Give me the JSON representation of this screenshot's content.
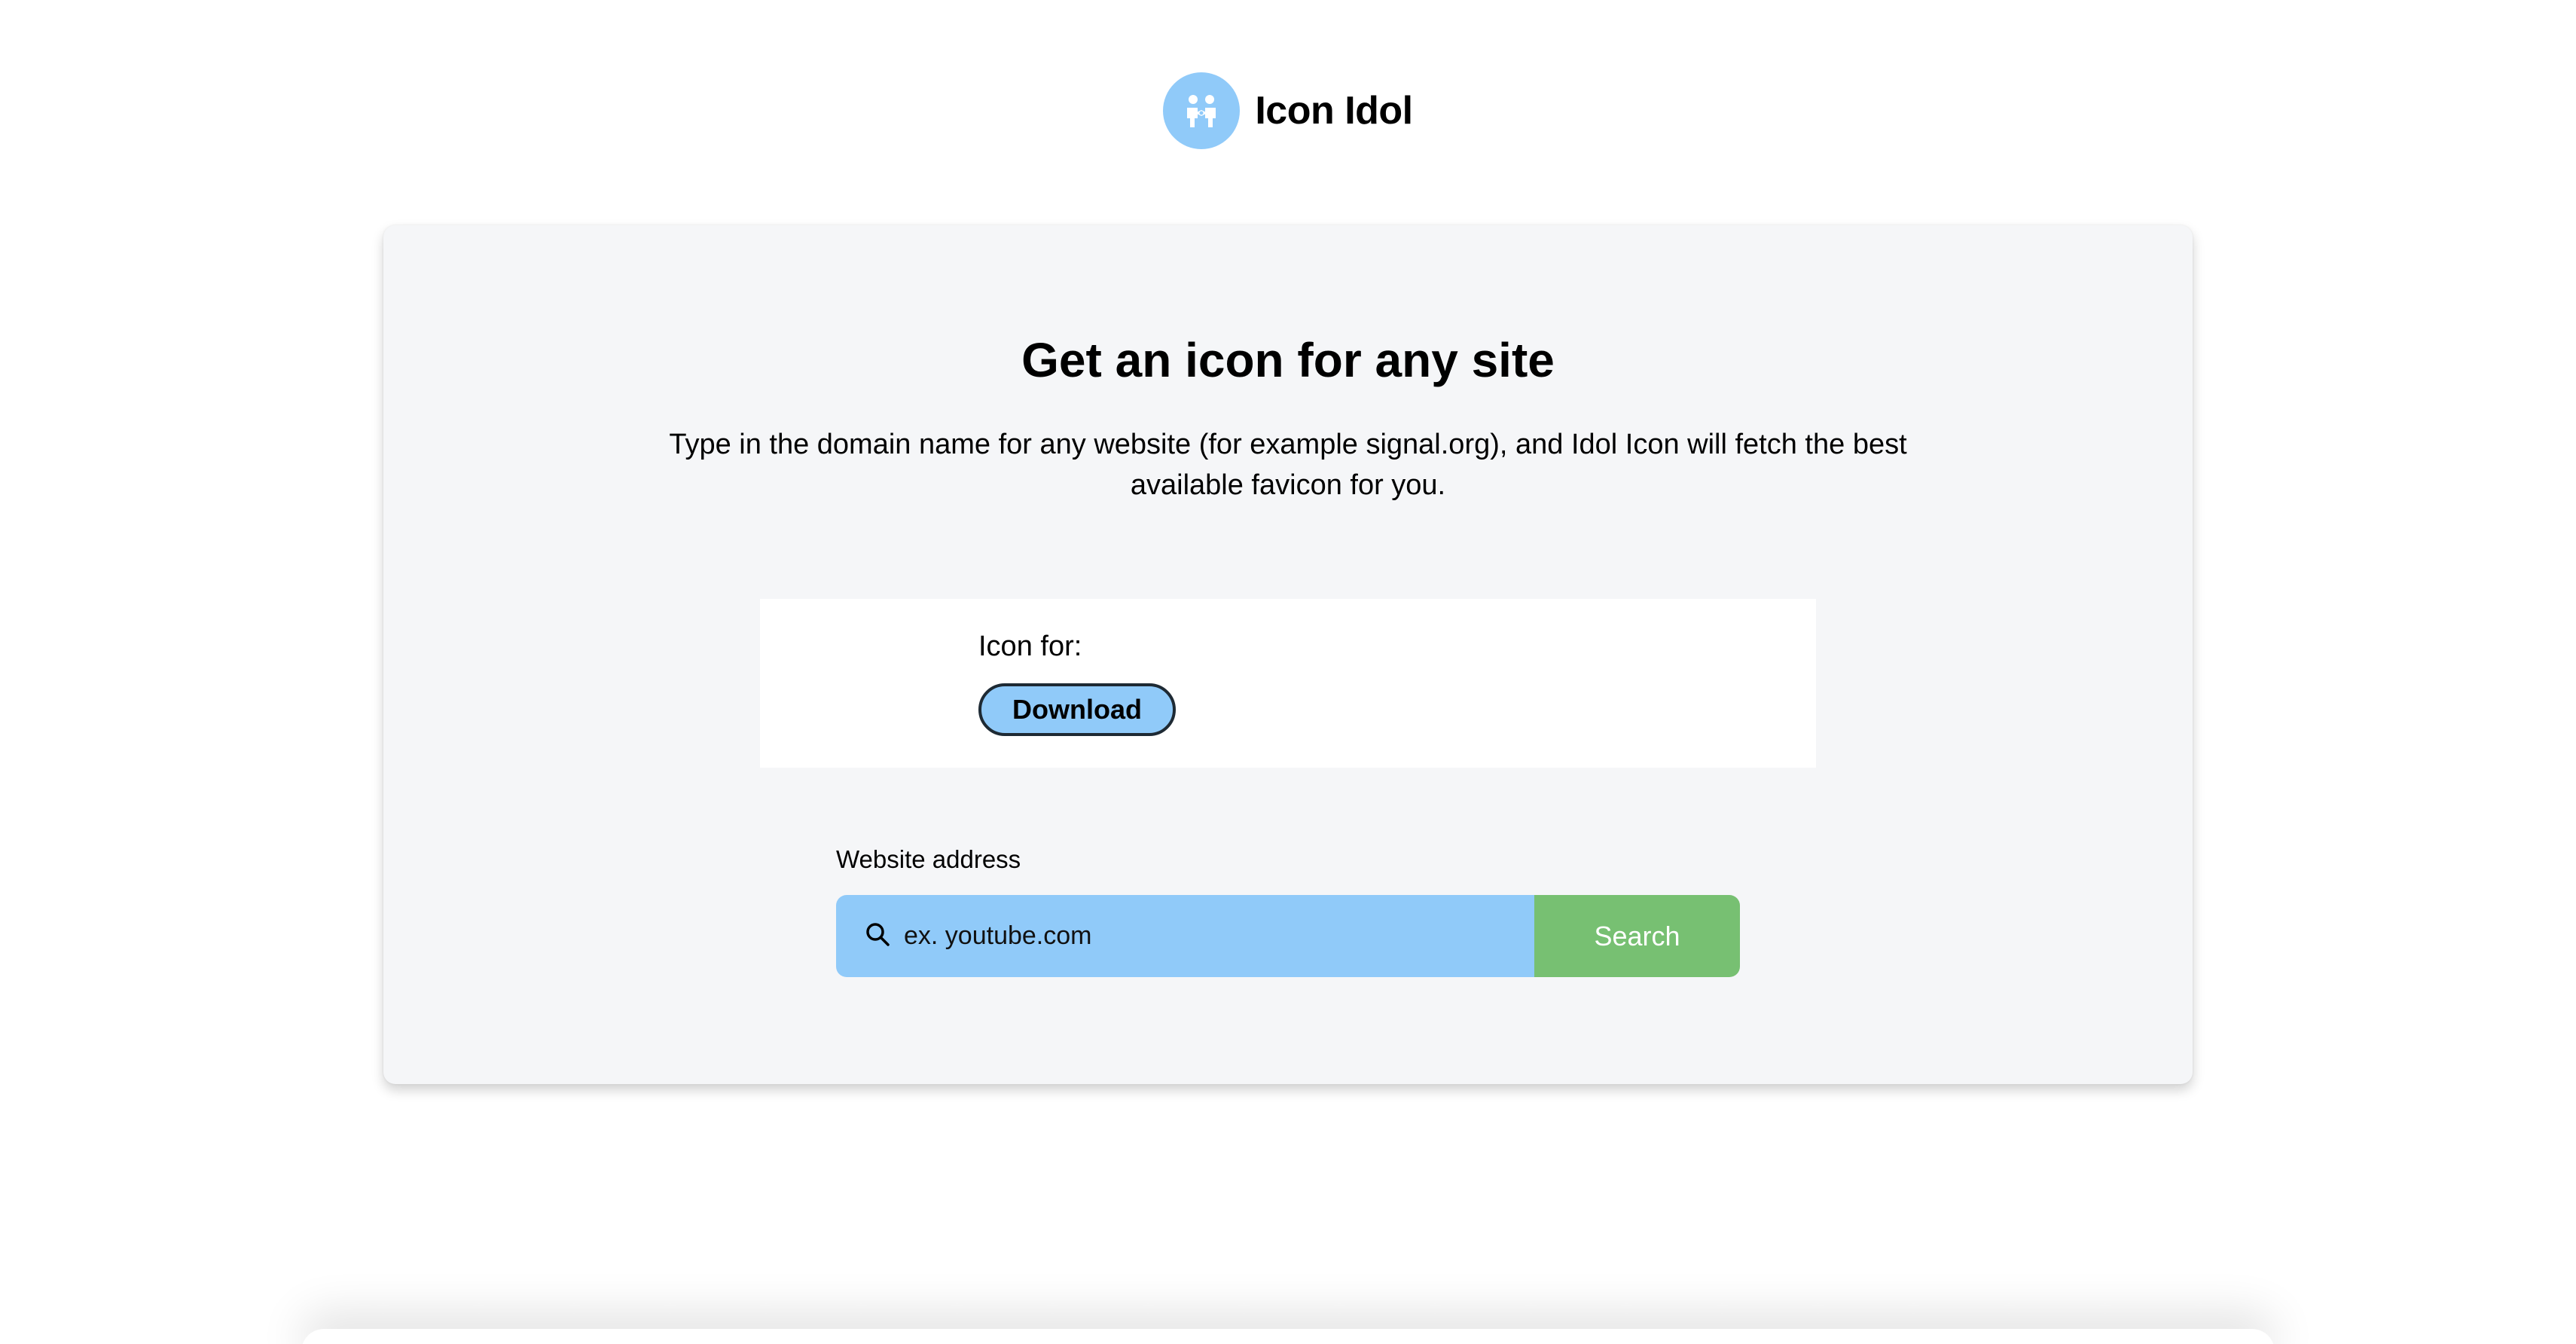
{
  "brand": {
    "name": "Icon Idol",
    "logo_icon": "people-icon",
    "logo_color": "#90caf9"
  },
  "card": {
    "title": "Get an icon for any site",
    "description": "Type in the domain name for any website (for example signal.org), and Idol Icon will fetch the best available favicon for you."
  },
  "result": {
    "icon_for_label": "Icon for:",
    "download_label": "Download"
  },
  "search": {
    "label": "Website address",
    "placeholder": "ex. youtube.com",
    "value": "",
    "button_label": "Search",
    "field_color": "#90caf9",
    "button_color": "#77c072"
  }
}
